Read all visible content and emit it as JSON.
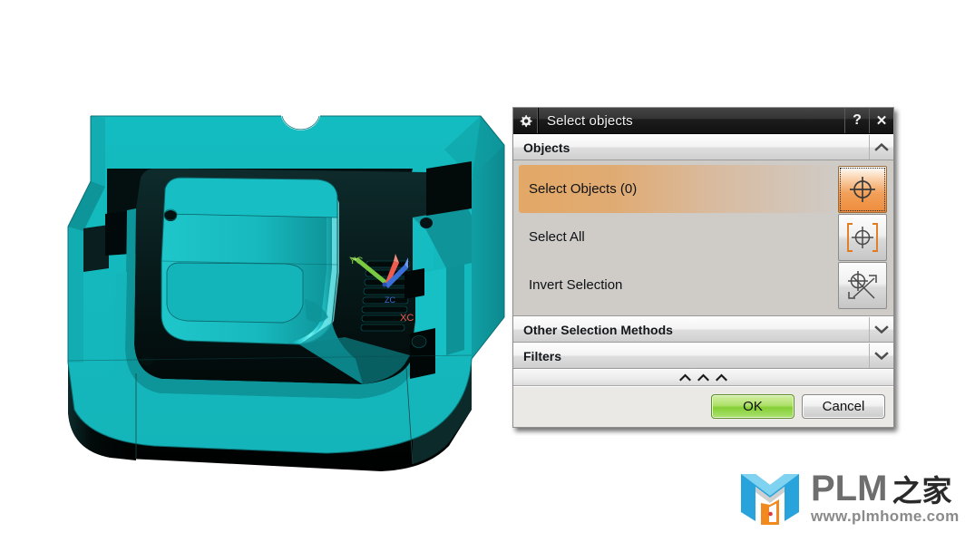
{
  "app": {
    "viewport_background": "#ffffff",
    "model_color": "#15b8bd",
    "model_shadow_color": "#05201f"
  },
  "viewport": {
    "name": "nx-graphics-window",
    "wcs_triad": {
      "x_label": "XC",
      "y_label": "YC",
      "z_label": "ZC",
      "x_color": "#ef5b4c",
      "y_color": "#7ac943",
      "z_color": "#3a6fd8"
    }
  },
  "dialog": {
    "title": "Select objects",
    "gear_icon": "gear-icon",
    "help_button": "?",
    "close_button": "✕",
    "groups": [
      {
        "label": "Objects",
        "expanded": true,
        "chevron": "⌃"
      },
      {
        "label": "Other Selection Methods",
        "expanded": false,
        "chevron": "⌄"
      },
      {
        "label": "Filters",
        "expanded": false,
        "chevron": "⌄"
      }
    ],
    "selection_rows": [
      {
        "label": "Select Objects (0)",
        "icon": "crosshair-target-icon",
        "active": true,
        "count": 0
      },
      {
        "label": "Select All",
        "icon": "crosshair-select-all-icon",
        "active": false
      },
      {
        "label": "Invert Selection",
        "icon": "crosshair-invert-icon",
        "active": false
      }
    ],
    "expander_marks": [
      "⌃",
      "⌃",
      "⌃"
    ],
    "buttons": {
      "ok": "OK",
      "cancel": "Cancel"
    },
    "accent_highlight_color": "#e3a866",
    "ok_button_color": "#85cf35"
  },
  "watermark": {
    "brand_latin": "PLM",
    "brand_cn": "之家",
    "url": "www.plmhome.com",
    "mark_colors": {
      "blue": "#29a3dc",
      "light_blue": "#7fd2f0",
      "orange": "#f08a1e",
      "gray": "#cfcfcf",
      "red_dot": "#e03a3a"
    }
  }
}
